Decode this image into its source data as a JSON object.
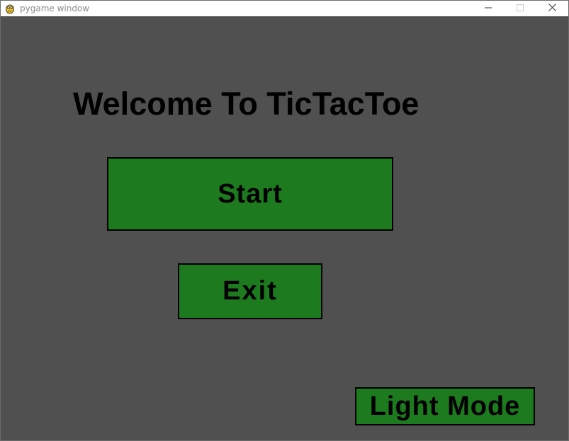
{
  "window": {
    "title": "pygame window",
    "icons": {
      "app": "pygame-snake-icon",
      "minimize": "minimize-icon",
      "maximize": "maximize-icon",
      "close": "close-icon"
    }
  },
  "game": {
    "background_color": "#505050",
    "button_color": "#1e7a1e",
    "heading": "Welcome To TicTacToe",
    "buttons": {
      "start": "Start",
      "exit": "Exit",
      "light_mode": "Light Mode"
    }
  }
}
